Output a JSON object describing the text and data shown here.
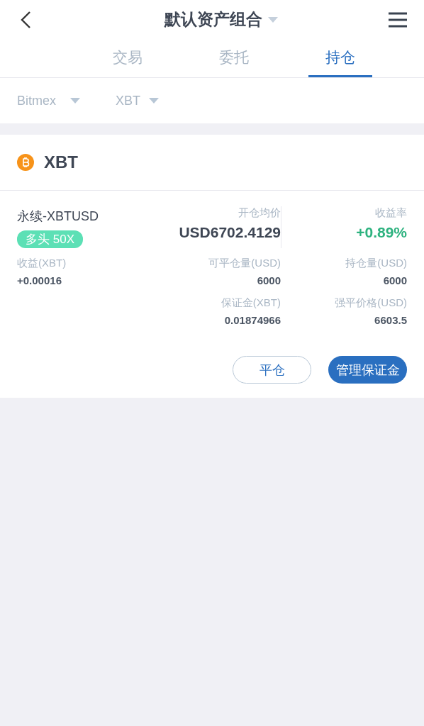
{
  "header": {
    "title": "默认资产组合"
  },
  "tabs": [
    {
      "label": "交易",
      "selected": false
    },
    {
      "label": "委托",
      "selected": false
    },
    {
      "label": "持仓",
      "selected": true
    }
  ],
  "filters": [
    {
      "label": "Bitmex"
    },
    {
      "label": "XBT"
    }
  ],
  "asset": {
    "name": "XBT"
  },
  "position": {
    "contract": "永续-XBTUSD",
    "badge": "多头 50X",
    "avg_open_price": {
      "label": "开仓均价",
      "value": "USD6702.4129"
    },
    "yield_rate": {
      "label": "收益率",
      "value": "+0.89%"
    },
    "pnl": {
      "label": "收益(XBT)",
      "value": "+0.00016"
    },
    "closable": {
      "label": "可平仓量(USD)",
      "value": "6000"
    },
    "holding": {
      "label": "持仓量(USD)",
      "value": "6000"
    },
    "margin": {
      "label": "保证金(XBT)",
      "value": "0.01874966"
    },
    "liquidation": {
      "label": "强平价格(USD)",
      "value": "6603.5"
    }
  },
  "buttons": [
    {
      "label": "平仓",
      "kind": "outline"
    },
    {
      "label": "管理保证金",
      "kind": "primary"
    }
  ]
}
